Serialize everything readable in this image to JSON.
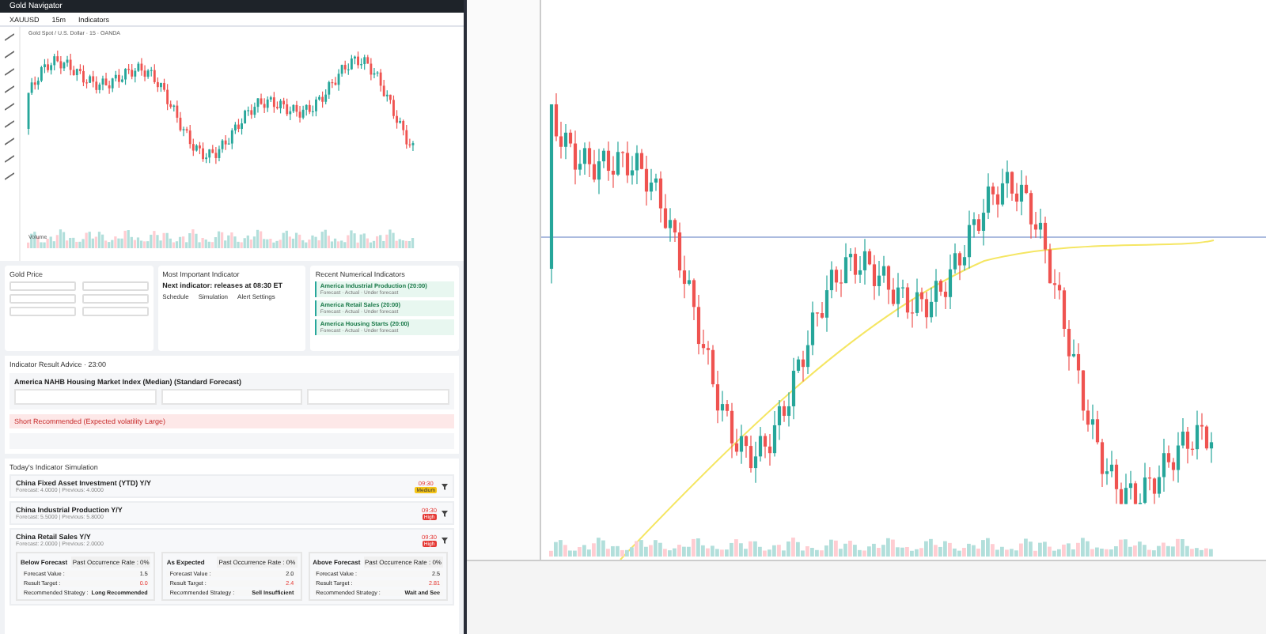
{
  "app": {
    "title": "Gold Navigator"
  },
  "toolbar": {
    "symbol": "XAUUSD",
    "interval": "15m",
    "indicators": "Indicators"
  },
  "chart": {
    "legend": "Gold Spot / U.S. Dollar · 15 · OANDA",
    "volume_label": "Volume"
  },
  "gold_price": {
    "title": "Gold Price"
  },
  "important_indicator": {
    "title": "Most Important Indicator",
    "headline": "Next indicator: releases at 08:30 ET",
    "actions": [
      "Schedule",
      "Simulation",
      "Alert Settings"
    ]
  },
  "recent": {
    "title": "Recent Numerical Indicators",
    "items": [
      {
        "title": "America Industrial Production (20:00)",
        "meta": "Forecast · Actual · Under forecast"
      },
      {
        "title": "America Retail Sales (20:00)",
        "meta": "Forecast · Actual · Under forecast"
      },
      {
        "title": "America Housing Starts (20:00)",
        "meta": "Forecast · Actual · Under forecast"
      }
    ]
  },
  "advice": {
    "title": "Indicator Result Advice · 23:00",
    "indicator": "America NAHB Housing Market Index (Median) (Standard Forecast)",
    "warning": "Short Recommended (Expected volatility Large)"
  },
  "simulation": {
    "title": "Today's Indicator Simulation",
    "rows": [
      {
        "title": "China Fixed Asset Investment (YTD) Y/Y",
        "sub": "Forecast: 4.0000 | Previous: 4.0000",
        "time": "09:30",
        "impact": "Medium",
        "color": "#f5c518",
        "expanded": false
      },
      {
        "title": "China Industrial Production Y/Y",
        "sub": "Forecast: 5.5000 | Previous: 5.8000",
        "time": "09:30",
        "impact": "High",
        "color": "#e53935",
        "expanded": false
      },
      {
        "title": "China Retail Sales Y/Y",
        "sub": "Forecast: 2.0000 | Previous: 2.0000",
        "time": "09:30",
        "impact": "High",
        "color": "#e53935",
        "expanded": true
      }
    ],
    "scenarios": [
      {
        "title": "Below Forecast",
        "rate": "Past Occurrence Rate : 0%",
        "labels": [
          "Forecast Value :",
          "Result Target :",
          "Recommended Strategy :"
        ],
        "forecast": "1.5",
        "target": "0.0",
        "strategy": "Long Recommended"
      },
      {
        "title": "As Expected",
        "rate": "Past Occurrence Rate : 0%",
        "labels": [
          "Forecast Value :",
          "Result Target :",
          "Recommended Strategy :"
        ],
        "forecast": "2.0",
        "target": "2.4",
        "strategy": "Sell Insufficient"
      },
      {
        "title": "Above Forecast",
        "rate": "Past Occurrence Rate : 0%",
        "labels": [
          "Forecast Value :",
          "Result Target :",
          "Recommended Strategy :"
        ],
        "forecast": "2.5",
        "target": "2.81",
        "strategy": "Wait and See"
      }
    ]
  }
}
